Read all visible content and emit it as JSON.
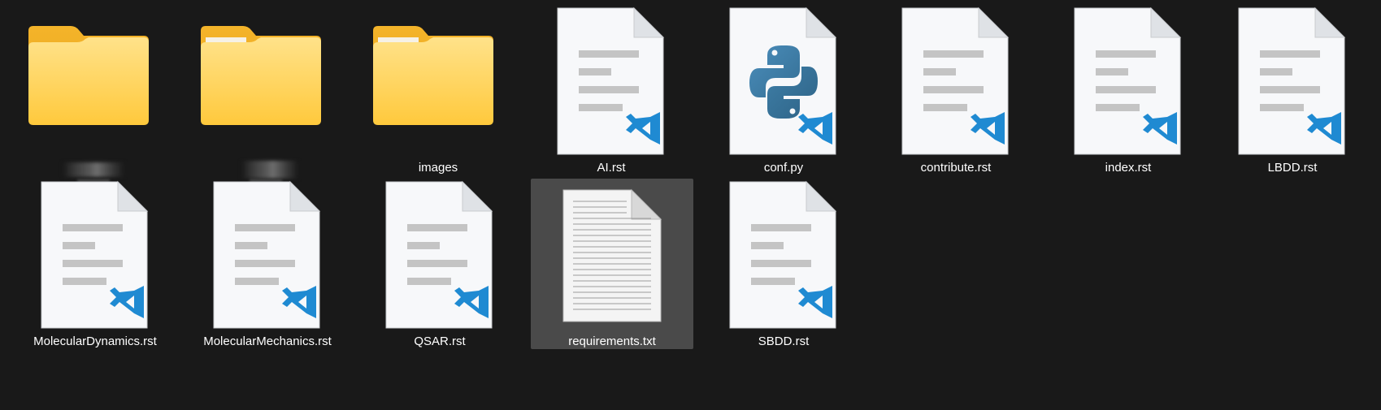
{
  "window": {
    "view": "large-icons"
  },
  "colors": {
    "background": "#191919",
    "folder": "#ffcf4d",
    "selection": "#4a4a4a",
    "vscode_blue": "#1f8ad2",
    "python_blue": "#3e7ea3"
  },
  "items": [
    {
      "name": "",
      "type": "folder",
      "icon": "folder-icon",
      "label_obscured": true
    },
    {
      "name": "",
      "type": "folder",
      "icon": "folder-icon",
      "label_obscured": true
    },
    {
      "name": "images",
      "type": "folder",
      "icon": "folder-icon"
    },
    {
      "name": "AI.rst",
      "type": "file",
      "icon": "vscode-document-icon"
    },
    {
      "name": "conf.py",
      "type": "file",
      "icon": "python-file-icon"
    },
    {
      "name": "contribute.rst",
      "type": "file",
      "icon": "vscode-document-icon"
    },
    {
      "name": "index.rst",
      "type": "file",
      "icon": "vscode-document-icon"
    },
    {
      "name": "LBDD.rst",
      "type": "file",
      "icon": "vscode-document-icon"
    },
    {
      "name": "MolecularDynamics.rst",
      "type": "file",
      "icon": "vscode-document-icon"
    },
    {
      "name": "MolecularMechanics.rst",
      "type": "file",
      "icon": "vscode-document-icon"
    },
    {
      "name": "QSAR.rst",
      "type": "file",
      "icon": "vscode-document-icon"
    },
    {
      "name": "requirements.txt",
      "type": "file",
      "icon": "text-document-icon",
      "selected": true
    },
    {
      "name": "SBDD.rst",
      "type": "file",
      "icon": "vscode-document-icon"
    }
  ]
}
